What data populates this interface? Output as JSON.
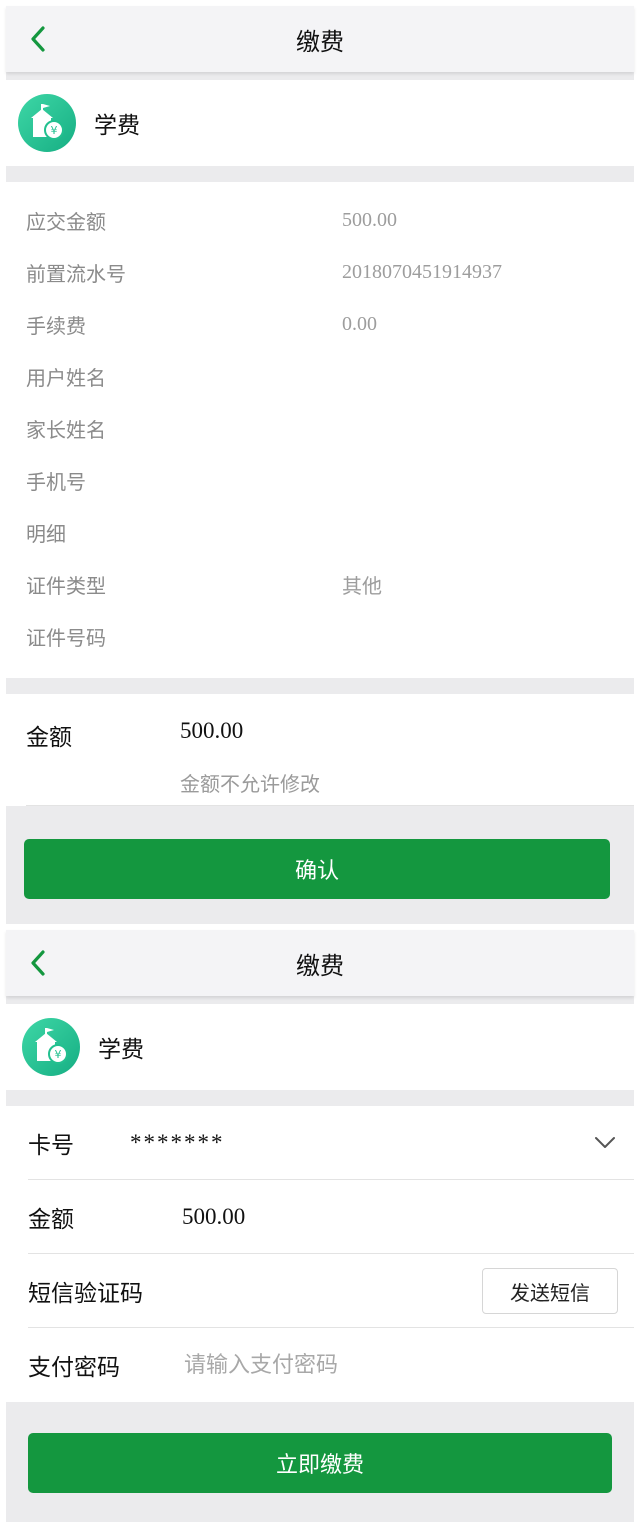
{
  "screen1": {
    "nav": {
      "title": "缴费"
    },
    "merchant": {
      "name": "学费"
    },
    "details": [
      {
        "label": "应交金额",
        "value": "500.00"
      },
      {
        "label": "前置流水号",
        "value": "2018070451914937"
      },
      {
        "label": "手续费",
        "value": "0.00"
      },
      {
        "label": "用户姓名",
        "value": ""
      },
      {
        "label": "家长姓名",
        "value": ""
      },
      {
        "label": "手机号",
        "value": ""
      },
      {
        "label": "明细",
        "value": ""
      },
      {
        "label": "证件类型",
        "value": "其他"
      },
      {
        "label": "证件号码",
        "value": ""
      }
    ],
    "amount": {
      "label": "金额",
      "value": "500.00",
      "hint": "金额不允许修改"
    },
    "confirm_button": "确认"
  },
  "screen2": {
    "nav": {
      "title": "缴费"
    },
    "merchant": {
      "name": "学费"
    },
    "card": {
      "label": "卡号",
      "value": "*******"
    },
    "amount": {
      "label": "金额",
      "value": "500.00"
    },
    "sms": {
      "label": "短信验证码",
      "button": "发送短信"
    },
    "password": {
      "label": "支付密码",
      "placeholder": "请输入支付密码"
    },
    "pay_button": "立即缴费"
  },
  "colors": {
    "primary": "#14973f",
    "logo": "#22c08f",
    "background": "#ebebed"
  }
}
